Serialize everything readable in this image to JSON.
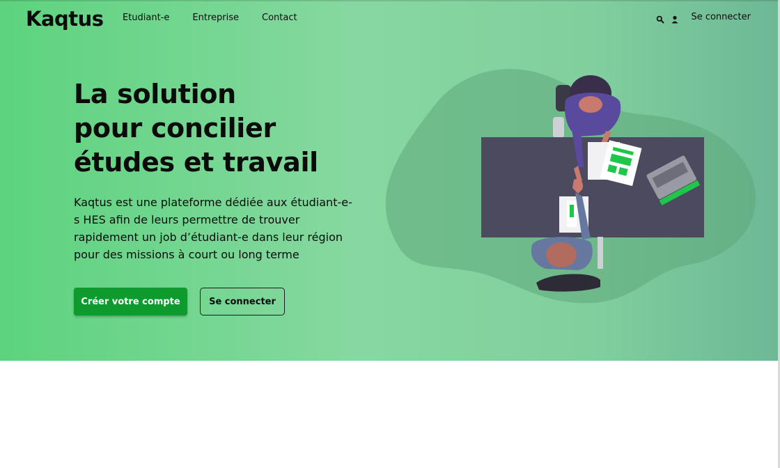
{
  "brand": {
    "name": "Kaqtus"
  },
  "nav": {
    "items": [
      {
        "label": "Etudiant-e"
      },
      {
        "label": "Entreprise"
      },
      {
        "label": "Contact"
      }
    ]
  },
  "header_right": {
    "search_icon": "search-icon",
    "user_icon": "user-icon",
    "login_label": "Se connecter"
  },
  "hero": {
    "headline": [
      "La solution",
      "pour concilier",
      "études et travail"
    ],
    "lead": "Kaqtus est une plateforme dédiée aux étudiant-e-s HES afin de leurs permettre de trouver rapidement un job d’étudiant-e dans leur région pour des missions à court ou long terme",
    "primary_button": "Créer votre compte",
    "secondary_button": "Se connecter"
  },
  "colors": {
    "accent": "#0f9a2e",
    "hero_gradient": [
      "#5dd37e",
      "#86d8a0",
      "#6db896"
    ],
    "illustration_green": "#1ec74a",
    "table": "#4c4a5e"
  },
  "illustration": {
    "icon": "handshake-meeting-illustration"
  }
}
